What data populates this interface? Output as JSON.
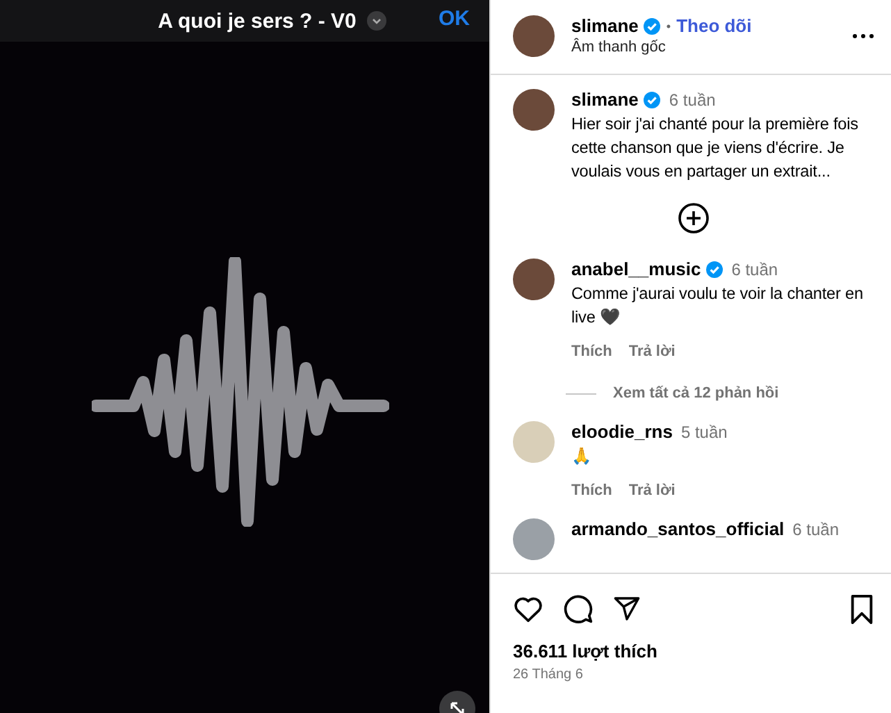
{
  "video": {
    "title": "A quoi je sers ? - V0",
    "ok": "OK"
  },
  "header": {
    "username": "slimane",
    "verified": true,
    "separator": "•",
    "follow": "Theo dõi",
    "audio": "Âm thanh gốc"
  },
  "caption": {
    "username": "slimane",
    "verified": true,
    "time": "6 tuần",
    "text": "Hier soir j'ai chanté pour la première fois cette chanson que je viens d'écrire. Je voulais vous en partager un extrait..."
  },
  "comments": [
    {
      "username": "anabel__music",
      "verified": true,
      "time": "6 tuần",
      "text": "Comme j'aurai voulu te voir la chanter en live 🖤",
      "like": "Thích",
      "reply": "Trả lời",
      "view_replies": "Xem tất cả 12 phản hồi"
    },
    {
      "username": "eloodie_rns",
      "verified": false,
      "time": "5 tuần",
      "text": "🙏",
      "like": "Thích",
      "reply": "Trả lời"
    },
    {
      "username": "armando_santos_official",
      "verified": false,
      "time": "6 tuần"
    }
  ],
  "likes": "36.611 lượt thích",
  "date": "26 Tháng 6"
}
